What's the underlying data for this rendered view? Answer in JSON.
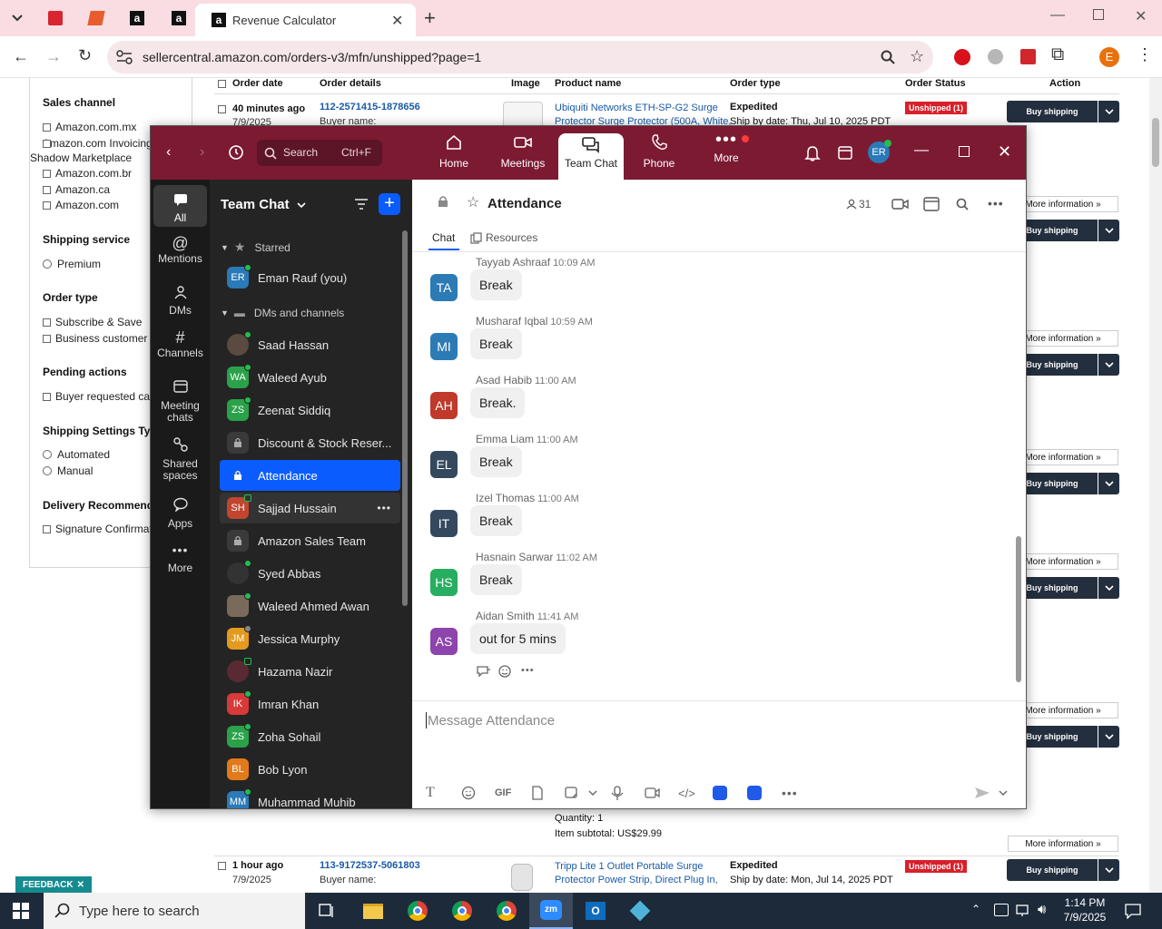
{
  "browser": {
    "active_tab_title": "Revenue Calculator",
    "url": "sellercentral.amazon.com/orders-v3/mfn/unshipped?page=1"
  },
  "amazon": {
    "filters": {
      "sales_channel": "Sales channel",
      "channels": [
        "Amazon.com.mx",
        "Amazon.com Invoicing Shadow Marketplace",
        "Amazon.com.br",
        "Amazon.ca",
        "Amazon.com"
      ],
      "shipping_service": "Shipping service",
      "premium": "Premium",
      "order_type": "Order type",
      "order_types": [
        "Subscribe & Save",
        "Business customer"
      ],
      "pending_actions": "Pending actions",
      "buyer_requested": "Buyer requested can",
      "shipping_settings": "Shipping Settings Type",
      "automated": "Automated",
      "manual": "Manual",
      "delivery_rec": "Delivery Recommenda",
      "signature": "Signature Confirmat",
      "feedback": "FEEDBACK"
    },
    "headers": {
      "order_date": "Order date",
      "order_details": "Order details",
      "image": "Image",
      "product_name": "Product name",
      "order_type": "Order type",
      "order_status": "Order Status",
      "action": "Action"
    },
    "order1": {
      "time": "40 minutes ago",
      "date": "7/9/2025",
      "id": "112-2571415-1878656",
      "buyer": "Buyer name:",
      "product_l1": "Ubiquiti Networks ETH-SP-G2 Surge",
      "product_l2": "Protector Surge Protector (500A, White,",
      "type": "Expedited",
      "ship_by": "Ship by date: Thu, Jul 10, 2025 PDT",
      "status": "Unshipped (1)"
    },
    "order2": {
      "quantity": "Quantity: 1",
      "subtotal": "Item subtotal: US$29.99",
      "time": "1 hour ago",
      "date": "7/9/2025",
      "id": "113-9172537-5061803",
      "buyer": "Buyer name:",
      "product_l1": "Tripp Lite 1 Outlet Portable Surge",
      "product_l2": "Protector Power Strip, Direct Plug In,",
      "type": "Expedited",
      "ship_by": "Ship by date: Mon, Jul 14, 2025 PDT",
      "status": "Unshipped (1)"
    },
    "buy_shipping": "Buy shipping",
    "more_information": "More information »"
  },
  "zoom": {
    "search": "Search",
    "search_shortcut": "Ctrl+F",
    "nav": {
      "home": "Home",
      "meetings": "Meetings",
      "team_chat": "Team Chat",
      "phone": "Phone",
      "more": "More"
    },
    "user_initials": "ER",
    "rail": {
      "all": "All",
      "mentions": "Mentions",
      "dms": "DMs",
      "channels": "Channels",
      "meeting_chats_1": "Meeting",
      "meeting_chats_2": "chats",
      "shared_1": "Shared",
      "shared_2": "spaces",
      "apps": "Apps",
      "more": "More"
    },
    "sidebar": {
      "title": "Team Chat",
      "starred": "Starred",
      "dms_channels": "DMs and channels",
      "items": [
        {
          "initials": "ER",
          "name": "Eman Rauf (you)",
          "color": "#2a7ab8"
        },
        {
          "initials": "",
          "name": "Saad Hassan",
          "color": "#5a4a40"
        },
        {
          "initials": "WA",
          "name": "Waleed Ayub",
          "color": "#2aa24a"
        },
        {
          "initials": "ZS",
          "name": "Zeenat Siddiq",
          "color": "#2aa24a"
        },
        {
          "initials": "",
          "name": "Discount & Stock Reser...",
          "color": "#3a3a3a"
        },
        {
          "initials": "",
          "name": "Attendance",
          "color": "#0b5cff"
        },
        {
          "initials": "SH",
          "name": "Sajjad Hussain",
          "color": "#c2452f"
        },
        {
          "initials": "",
          "name": "Amazon Sales Team",
          "color": "#3a3a3a"
        },
        {
          "initials": "",
          "name": "Syed Abbas",
          "color": "#333333"
        },
        {
          "initials": "",
          "name": "Waleed Ahmed Awan",
          "color": "#7a6a5a"
        },
        {
          "initials": "JM",
          "name": "Jessica Murphy",
          "color": "#e39a1f"
        },
        {
          "initials": "",
          "name": "Hazama Nazir",
          "color": "#5a2a34"
        },
        {
          "initials": "IK",
          "name": "Imran Khan",
          "color": "#d83a3a"
        },
        {
          "initials": "ZS",
          "name": "Zoha Sohail",
          "color": "#2aa24a"
        },
        {
          "initials": "BL",
          "name": "Bob Lyon",
          "color": "#e27a1a"
        },
        {
          "initials": "MM",
          "name": "Muhammad Muhib",
          "color": "#2a7ab8"
        }
      ]
    },
    "channel": {
      "name": "Attendance",
      "members": "31",
      "tab_chat": "Chat",
      "tab_resources": "Resources"
    },
    "messages": [
      {
        "initials": "TA",
        "name": "Tayyab Ashraaf",
        "time": "10:09 AM",
        "text": "Break",
        "color": "#2d7bb5"
      },
      {
        "initials": "MI",
        "name": "Musharaf Iqbal",
        "time": "10:59 AM",
        "text": "Break",
        "color": "#2d7bb5"
      },
      {
        "initials": "AH",
        "name": "Asad Habib",
        "time": "11:00 AM",
        "text": "Break.",
        "color": "#c0392b"
      },
      {
        "initials": "EL",
        "name": "Emma Liam",
        "time": "11:00 AM",
        "text": "Break",
        "color": "#34495e"
      },
      {
        "initials": "IT",
        "name": "Izel Thomas",
        "time": "11:00 AM",
        "text": "Break",
        "color": "#34495e"
      },
      {
        "initials": "HS",
        "name": "Hasnain Sarwar",
        "time": "11:02 AM",
        "text": "Break",
        "color": "#27ae60"
      },
      {
        "initials": "AS",
        "name": "Aidan Smith",
        "time": "11:41 AM",
        "text": "out for 5 mins",
        "color": "#8e44ad"
      }
    ],
    "composer_placeholder": "Message Attendance",
    "gif": "GIF"
  },
  "taskbar": {
    "search_placeholder": "Type here to search",
    "time": "1:14 PM",
    "date": "7/9/2025"
  }
}
